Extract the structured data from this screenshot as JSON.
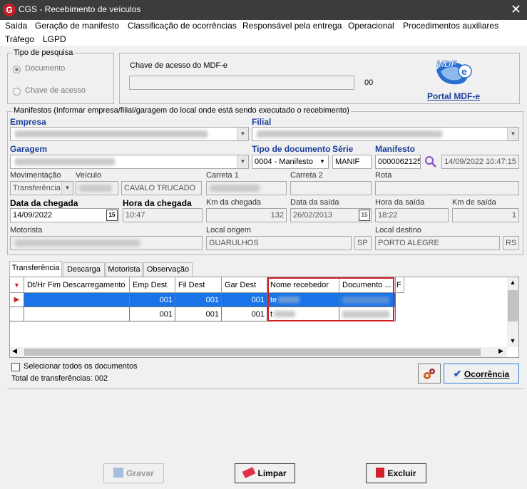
{
  "window": {
    "title": "CGS - Recebimento de veículos",
    "close": "✕",
    "app_icon": "G"
  },
  "menu": [
    "Saída",
    "Geração de manifesto",
    "Classificação de ocorrências",
    "Responsável pela entrega",
    "Operacional",
    "Procedimentos auxiliares",
    "Tráfego",
    "LGPD"
  ],
  "tipo_pesquisa": {
    "label": "Tipo de pesquisa",
    "opt1": "Documento",
    "opt2": "Chave de acesso"
  },
  "mdfe": {
    "chave_label": "Chave de acesso do MDF-e",
    "count": "00",
    "portal_link": "Portal MDF-e",
    "logo_text": "MDF"
  },
  "manifestos": {
    "label": "Manifestos (Informar empresa/filial/garagem do local onde está sendo executado o recebimento)",
    "empresa_label": "Empresa",
    "filial_label": "Filial",
    "garagem_label": "Garagem",
    "tipo_doc_label": "Tipo de documento",
    "serie_label": "Série",
    "manifesto_label": "Manifesto",
    "tipo_doc_value": "0004 - Manifesto",
    "serie_value": "MANIF",
    "manifesto_value": "0000062125",
    "manifesto_date": "14/09/2022 10:47:15",
    "mov_label": "Movimentação",
    "mov_value": "Transferência",
    "veiculo_label": "Veículo",
    "veiculo_desc": "CAVALO TRUCADO",
    "carreta1_label": "Carreta 1",
    "carreta2_label": "Carreta 2",
    "rota_label": "Rota",
    "data_chegada_label": "Data da chegada",
    "data_chegada_value": "14/09/2022",
    "hora_chegada_label": "Hora da chegada",
    "hora_chegada_value": "10:47",
    "km_chegada_label": "Km da chegada",
    "km_chegada_value": "132",
    "data_saida_label": "Data da saída",
    "data_saida_value": "26/02/2013",
    "hora_saida_label": "Hora da saída",
    "hora_saida_value": "18:22",
    "km_saida_label": "Km de saída",
    "km_saida_value": "1",
    "motorista_label": "Motorista",
    "origem_label": "Local origem",
    "origem_value": "GUARULHOS",
    "origem_uf": "SP",
    "destino_label": "Local destino",
    "destino_value": "PORTO ALEGRE",
    "destino_uf": "RS",
    "cal_icon": "15"
  },
  "tabs": [
    "Transferência",
    "Descarga",
    "Motorista",
    "Observação"
  ],
  "grid": {
    "columns": [
      "Dt/Hr Fim Descarregamento",
      "Emp Dest",
      "Fil Dest",
      "Gar Dest",
      "Nome recebedor",
      "Documento ...",
      "F"
    ],
    "rows": [
      {
        "emp": "001",
        "fil": "001",
        "gar": "001",
        "nome": "te"
      },
      {
        "emp": "001",
        "fil": "001",
        "gar": "001",
        "nome": "t"
      }
    ]
  },
  "footer": {
    "select_all": "Selecionar todos os documentos",
    "total": "Total de transferências: 002",
    "ocorrencia": "Ocorrência"
  },
  "buttons": {
    "gravar": "Gravar",
    "limpar": "Limpar",
    "excluir": "Excluir"
  },
  "colors": {
    "selection": "#1874e8",
    "highlight": "#d0202a",
    "link": "#1c3f9b"
  }
}
